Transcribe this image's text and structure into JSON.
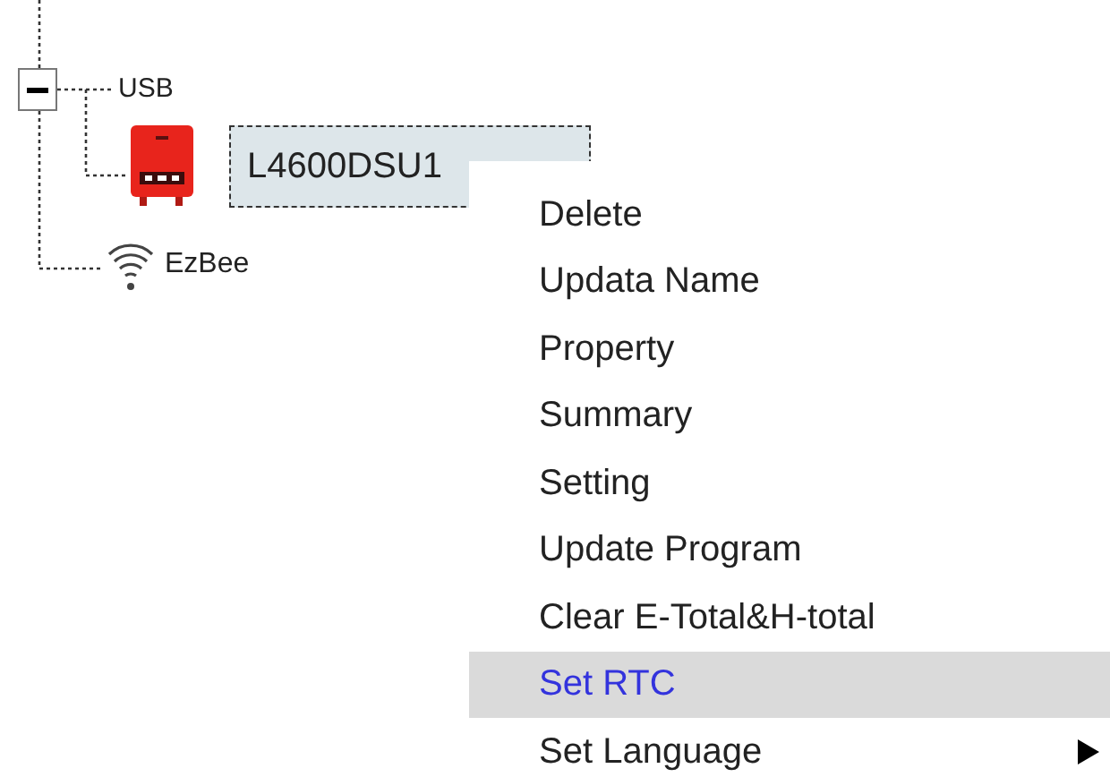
{
  "tree": [
    {
      "label": "USB",
      "expanded": true,
      "children": [
        {
          "label": "L4600DSU1",
          "kind": "inverter",
          "selected": true
        }
      ]
    },
    {
      "label": "EzBee",
      "kind": "wireless"
    }
  ],
  "context_menu": {
    "items": [
      {
        "label": "Delete",
        "selected": false,
        "submenu": false
      },
      {
        "label": "Updata Name",
        "selected": false,
        "submenu": false
      },
      {
        "label": "Property",
        "selected": false,
        "submenu": false
      },
      {
        "label": "Summary",
        "selected": false,
        "submenu": false
      },
      {
        "label": "Setting",
        "selected": false,
        "submenu": false
      },
      {
        "label": "Update Program",
        "selected": false,
        "submenu": false
      },
      {
        "label": "Clear E-Total&H-total",
        "selected": false,
        "submenu": false
      },
      {
        "label": "Set RTC",
        "selected": true,
        "submenu": false
      },
      {
        "label": "Set Language",
        "selected": false,
        "submenu": true
      }
    ]
  }
}
